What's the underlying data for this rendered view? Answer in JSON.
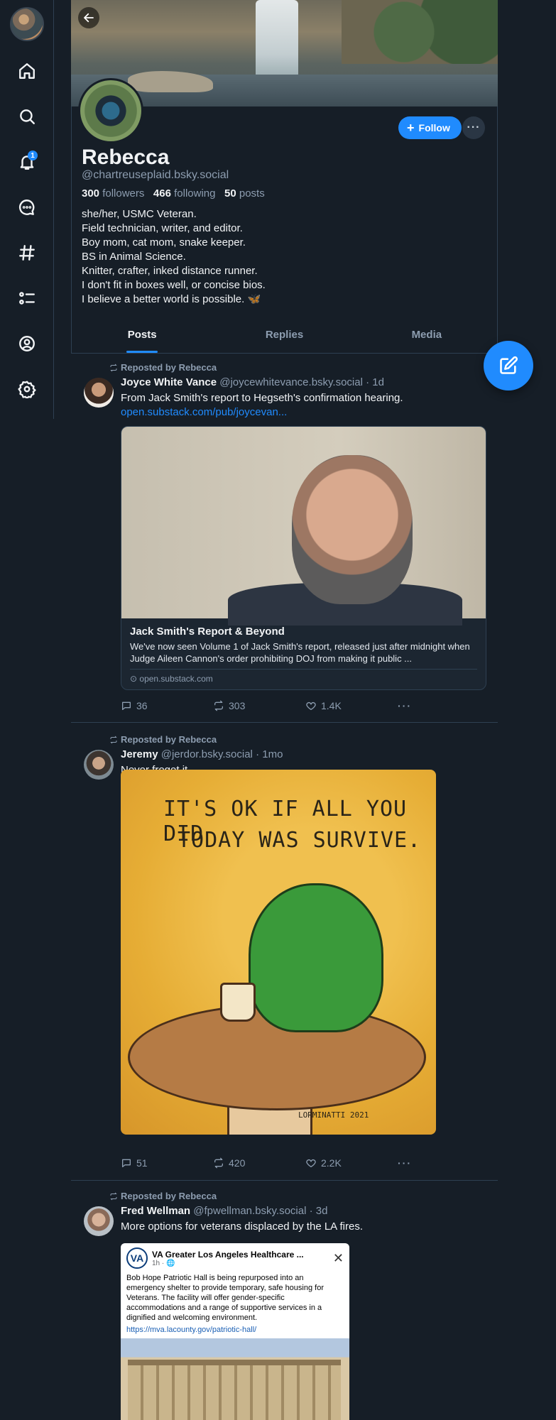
{
  "profile": {
    "name": "Rebecca",
    "handle": "@chartreuseplaid.bsky.social",
    "followers_count": "300",
    "followers_label": "followers",
    "following_count": "466",
    "following_label": "following",
    "posts_count": "50",
    "posts_label": "posts",
    "bio": [
      "she/her, USMC Veteran.",
      "Field technician, writer, and editor.",
      "Boy mom, cat mom, snake keeper.",
      "BS in Animal Science.",
      "Knitter, crafter, inked distance runner.",
      "I don't fit in boxes well, or concise bios.",
      "I believe a better world is possible. 🦋"
    ],
    "follow_label": "Follow",
    "more_label": "···"
  },
  "nav": {
    "notification_count": "1",
    "icons": [
      "home-icon",
      "search-icon",
      "bell-icon",
      "chat-icon",
      "hashtag-icon",
      "list-icon",
      "profile-icon",
      "gear-icon"
    ]
  },
  "tabs": [
    "Posts",
    "Replies",
    "Media"
  ],
  "accent": "#208bfe",
  "posts": [
    {
      "repost_label": "Reposted by Rebecca",
      "author": "Joyce White Vance",
      "handle": "@joycewhitevance.bsky.social",
      "time": "· 1d",
      "text": "From Jack Smith's report to Hegseth's confirmation hearing.",
      "link": "open.substack.com/pub/joycevan...",
      "card": {
        "title": "Jack Smith's Report & Beyond",
        "description": "We've now seen Volume 1 of Jack Smith's report, released just after midnight when Judge Aileen Cannon's order prohibiting DOJ from making it public ...",
        "source": "open.substack.com"
      },
      "replies": "36",
      "reposts": "303",
      "likes": "1.4K"
    },
    {
      "repost_label": "Reposted by Rebecca",
      "author": "Jeremy",
      "handle": "@jerdor.bsky.social",
      "time": "· 1mo",
      "text": "Never froget it.",
      "image_text": [
        "IT'S OK IF ALL YOU DID",
        "TODAY WAS SURVIVE."
      ],
      "image_signature": "LORMINATTI 2021",
      "replies": "51",
      "reposts": "420",
      "likes": "2.2K"
    },
    {
      "repost_label": "Reposted by Rebecca",
      "author": "Fred Wellman",
      "handle": "@fpwellman.bsky.social",
      "time": "· 3d",
      "text": "More options for veterans displaced by the LA fires.",
      "embed": {
        "logo": "VA",
        "page_name": "VA Greater Los Angeles Healthcare ...",
        "meta": "1h · 🌐",
        "body": "Bob Hope Patriotic Hall is being repurposed into an emergency shelter to provide temporary, safe housing for Veterans. The facility will offer gender-specific accommodations and a range of supportive services in a dignified and welcoming environment.",
        "link": "https://mva.lacounty.gov/patriotic-hall/"
      }
    }
  ]
}
